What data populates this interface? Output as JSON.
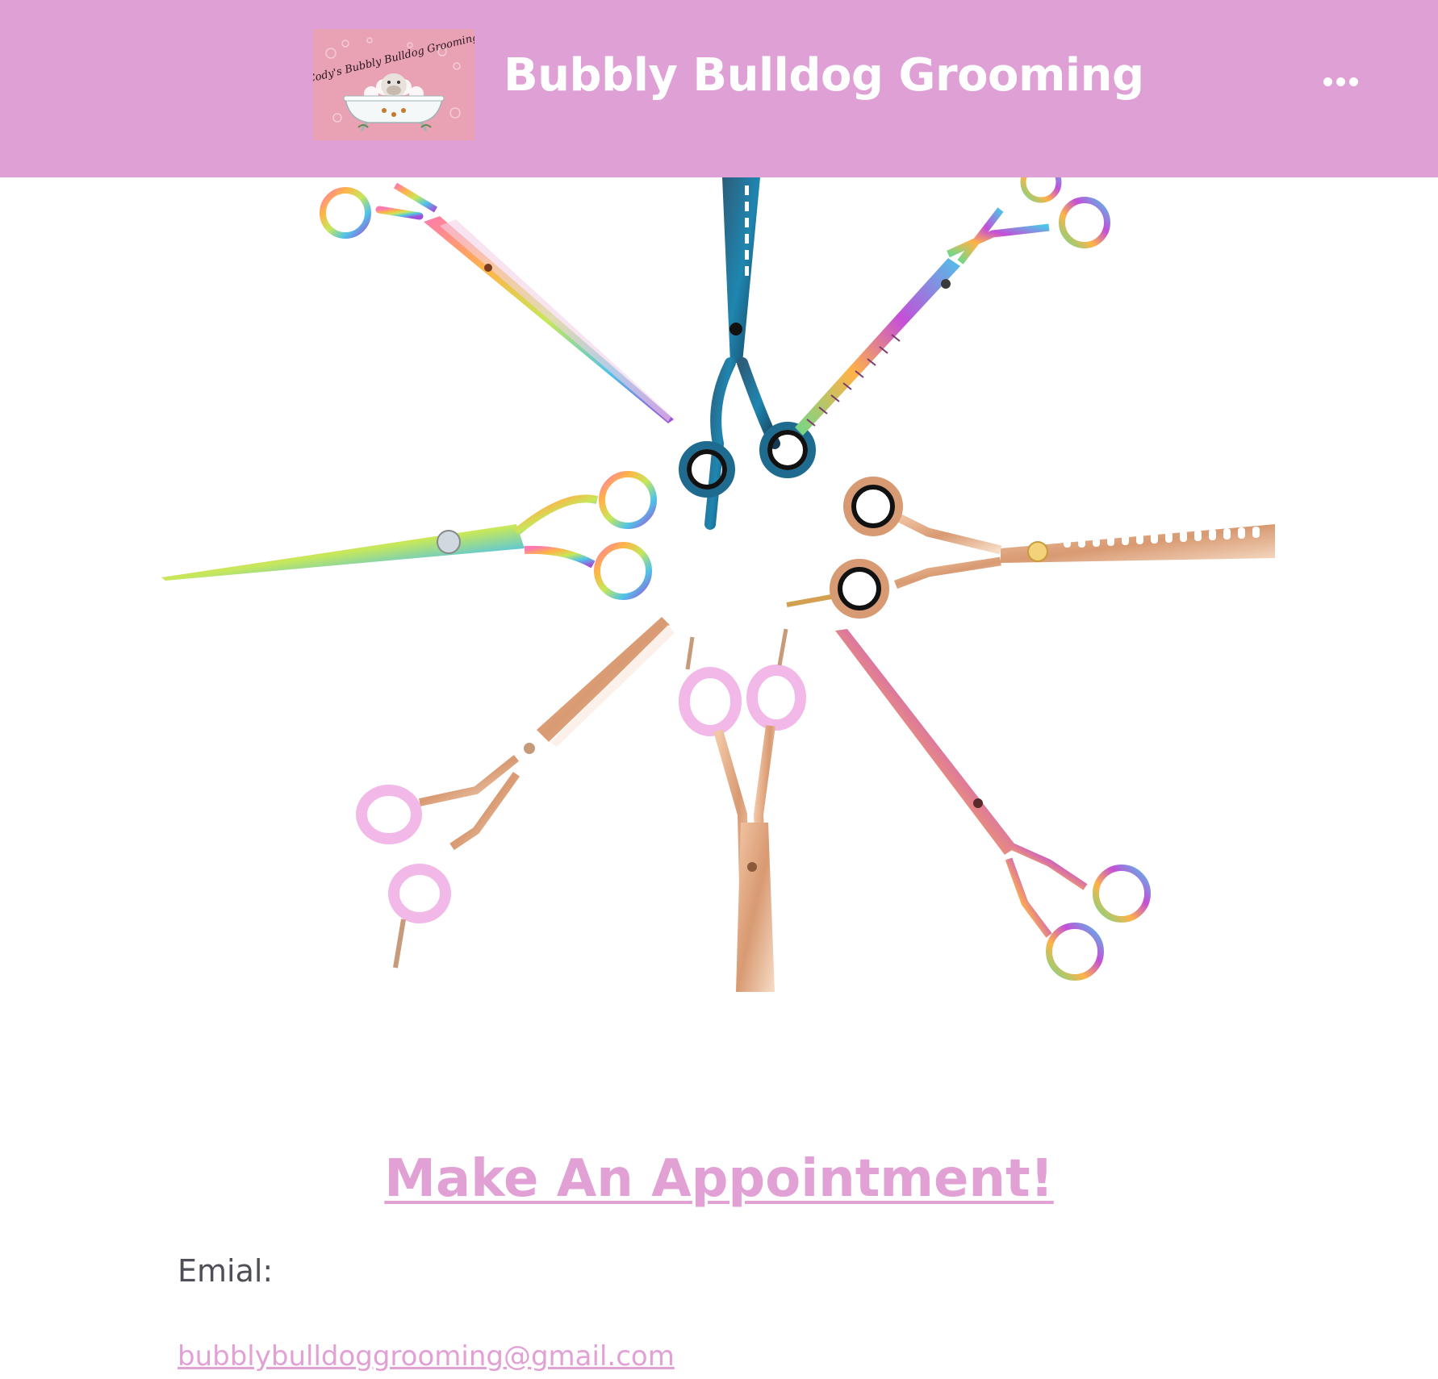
{
  "header": {
    "logo_text": "Cody's Bubbly Bulldog Grooming",
    "site_title": "Bubbly Bulldog Grooming",
    "menu_icon": "more-horizontal-icon",
    "background_color": "#dfa0d5"
  },
  "hero": {
    "image_subject": "grooming-scissors"
  },
  "content": {
    "heading": "Make An Appointment!",
    "email_label": "Emial:",
    "email_address": "bubblybulldoggrooming@gmail.com",
    "accent_color": "#e2a1d4",
    "text_color": "#4e4f57"
  }
}
